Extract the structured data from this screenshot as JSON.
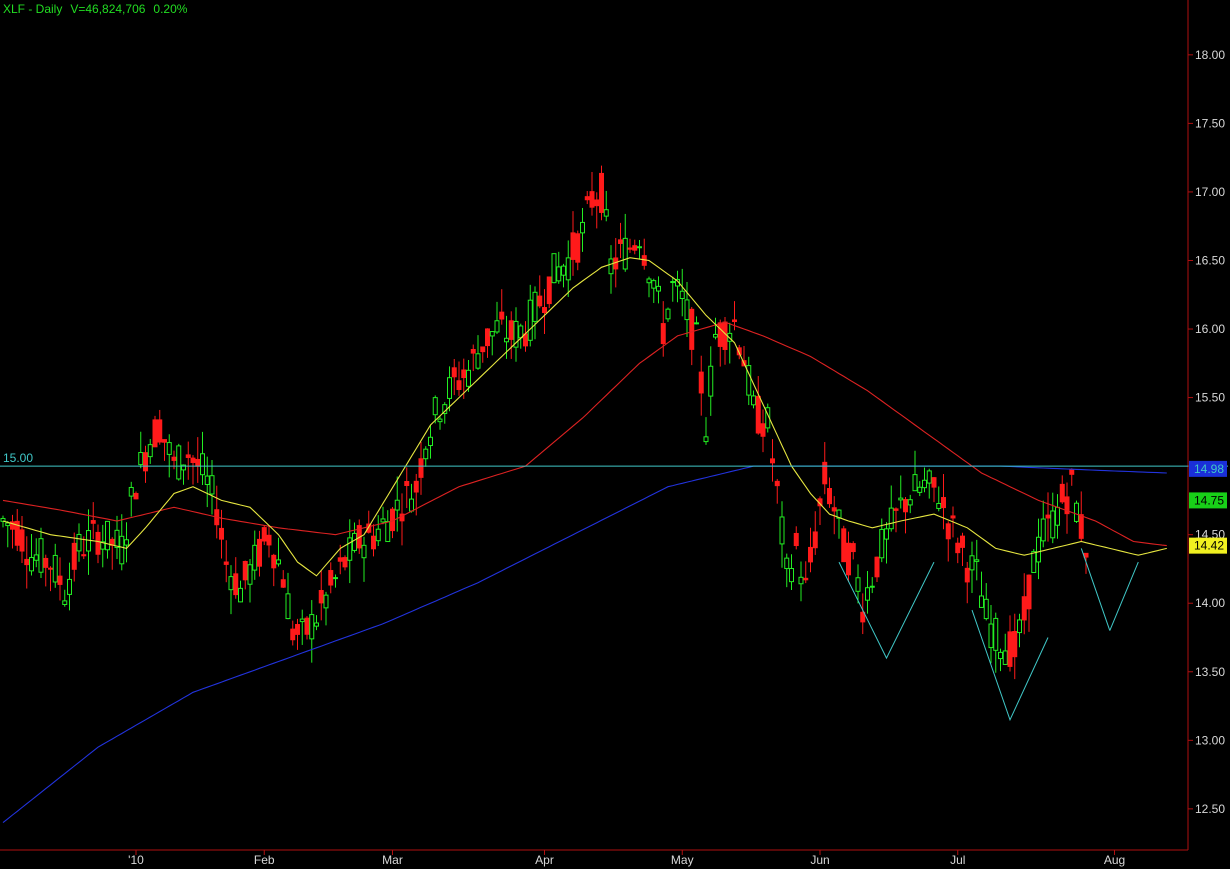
{
  "header": {
    "symbol_interval": "XLF - Daily",
    "volume": "V=46,824,706",
    "change": "0.20%"
  },
  "chart_data": {
    "type": "candlestick",
    "ylim": [
      12.2,
      18.4
    ],
    "y_ticks": [
      "18.00",
      "17.50",
      "17.00",
      "16.50",
      "16.00",
      "15.50",
      "15.00",
      "14.50",
      "14.00",
      "13.50",
      "13.00",
      "12.50"
    ],
    "x_ticks": [
      "'10",
      "Feb",
      "Mar",
      "Apr",
      "May",
      "Jun",
      "Jul",
      "Aug"
    ],
    "x_tick_bar_index": [
      28,
      55,
      82,
      114,
      143,
      172,
      201,
      234
    ],
    "bar_count": 229,
    "horizontal_line": {
      "label": "15.00",
      "value": 15.0,
      "color": "#40c8c8"
    },
    "price_badges": [
      {
        "label": "14.98",
        "value": 14.98,
        "bg": "#1a2fd8",
        "fg": "#40c8c8"
      },
      {
        "label": "14.75",
        "value": 14.75,
        "bg": "#18d018",
        "fg": "#000000"
      },
      {
        "label": "14.42",
        "value": 14.42,
        "bg": "#f0f020",
        "fg": "#000000"
      }
    ],
    "colors": {
      "up": "#22ee22",
      "down": "#ff1a1a",
      "ma_short": "#e6e640",
      "ma_mid": "#dd2222",
      "ma_long": "#2233dd",
      "pattern": "#40c8c8"
    },
    "price_anchors": [
      [
        0,
        14.6
      ],
      [
        3,
        14.55
      ],
      [
        6,
        14.35
      ],
      [
        10,
        14.3
      ],
      [
        13,
        14.1
      ],
      [
        16,
        14.4
      ],
      [
        20,
        14.5
      ],
      [
        25,
        14.4
      ],
      [
        28,
        14.9
      ],
      [
        31,
        15.2
      ],
      [
        33,
        15.3
      ],
      [
        36,
        15.0
      ],
      [
        39,
        15.1
      ],
      [
        42,
        14.95
      ],
      [
        45,
        14.7
      ],
      [
        47,
        14.3
      ],
      [
        50,
        14.1
      ],
      [
        53,
        14.3
      ],
      [
        56,
        14.5
      ],
      [
        59,
        14.2
      ],
      [
        61,
        13.8
      ],
      [
        63,
        13.75
      ],
      [
        66,
        13.9
      ],
      [
        69,
        14.1
      ],
      [
        72,
        14.3
      ],
      [
        75,
        14.45
      ],
      [
        78,
        14.5
      ],
      [
        81,
        14.6
      ],
      [
        84,
        14.75
      ],
      [
        87,
        14.85
      ],
      [
        89,
        15.2
      ],
      [
        92,
        15.45
      ],
      [
        95,
        15.6
      ],
      [
        98,
        15.7
      ],
      [
        101,
        15.9
      ],
      [
        104,
        16.0
      ],
      [
        107,
        15.95
      ],
      [
        110,
        16.0
      ],
      [
        113,
        16.2
      ],
      [
        116,
        16.4
      ],
      [
        119,
        16.5
      ],
      [
        122,
        16.7
      ],
      [
        124,
        16.95
      ],
      [
        126,
        17.0
      ],
      [
        128,
        16.45
      ],
      [
        130,
        16.55
      ],
      [
        132,
        16.6
      ],
      [
        134,
        16.7
      ],
      [
        137,
        16.35
      ],
      [
        139,
        16.0
      ],
      [
        141,
        16.3
      ],
      [
        143,
        16.2
      ],
      [
        146,
        15.9
      ],
      [
        148,
        15.3
      ],
      [
        150,
        15.95
      ],
      [
        152,
        16.0
      ],
      [
        154,
        16.05
      ],
      [
        156,
        15.8
      ],
      [
        158,
        15.4
      ],
      [
        161,
        15.3
      ],
      [
        163,
        14.8
      ],
      [
        165,
        14.2
      ],
      [
        167,
        14.4
      ],
      [
        169,
        14.1
      ],
      [
        171,
        14.5
      ],
      [
        173,
        14.9
      ],
      [
        175,
        14.7
      ],
      [
        177,
        14.4
      ],
      [
        179,
        14.3
      ],
      [
        181,
        14.0
      ],
      [
        183,
        14.2
      ],
      [
        185,
        14.4
      ],
      [
        187,
        14.55
      ],
      [
        189,
        14.7
      ],
      [
        191,
        14.8
      ],
      [
        194,
        14.85
      ],
      [
        197,
        14.8
      ],
      [
        199,
        14.6
      ],
      [
        201,
        14.45
      ],
      [
        203,
        14.3
      ],
      [
        205,
        14.2
      ],
      [
        207,
        13.9
      ],
      [
        209,
        13.75
      ],
      [
        211,
        13.7
      ],
      [
        213,
        13.65
      ],
      [
        215,
        13.9
      ],
      [
        217,
        14.3
      ],
      [
        219,
        14.5
      ],
      [
        221,
        14.6
      ],
      [
        223,
        14.75
      ],
      [
        225,
        14.85
      ],
      [
        227,
        14.55
      ],
      [
        229,
        14.3
      ],
      [
        231,
        14.2
      ],
      [
        233,
        14.1
      ],
      [
        235,
        14.0
      ],
      [
        237,
        14.25
      ],
      [
        239,
        14.5
      ],
      [
        241,
        14.9
      ],
      [
        243,
        14.7
      ],
      [
        245,
        14.75
      ]
    ],
    "ma_short_anchors": [
      [
        0,
        14.6
      ],
      [
        10,
        14.5
      ],
      [
        20,
        14.45
      ],
      [
        26,
        14.4
      ],
      [
        30,
        14.55
      ],
      [
        36,
        14.8
      ],
      [
        40,
        14.85
      ],
      [
        46,
        14.75
      ],
      [
        52,
        14.7
      ],
      [
        58,
        14.5
      ],
      [
        62,
        14.3
      ],
      [
        66,
        14.2
      ],
      [
        71,
        14.4
      ],
      [
        76,
        14.5
      ],
      [
        83,
        14.9
      ],
      [
        90,
        15.3
      ],
      [
        96,
        15.5
      ],
      [
        102,
        15.7
      ],
      [
        108,
        15.9
      ],
      [
        114,
        16.1
      ],
      [
        120,
        16.3
      ],
      [
        126,
        16.45
      ],
      [
        132,
        16.52
      ],
      [
        136,
        16.5
      ],
      [
        142,
        16.35
      ],
      [
        148,
        16.1
      ],
      [
        154,
        15.9
      ],
      [
        158,
        15.6
      ],
      [
        162,
        15.3
      ],
      [
        166,
        15.0
      ],
      [
        170,
        14.8
      ],
      [
        174,
        14.65
      ],
      [
        178,
        14.6
      ],
      [
        183,
        14.55
      ],
      [
        189,
        14.6
      ],
      [
        196,
        14.65
      ],
      [
        203,
        14.55
      ],
      [
        209,
        14.4
      ],
      [
        215,
        14.35
      ],
      [
        221,
        14.4
      ],
      [
        227,
        14.45
      ],
      [
        233,
        14.4
      ],
      [
        239,
        14.35
      ],
      [
        245,
        14.4
      ]
    ],
    "ma_mid_anchors": [
      [
        0,
        14.75
      ],
      [
        12,
        14.68
      ],
      [
        24,
        14.6
      ],
      [
        36,
        14.7
      ],
      [
        46,
        14.62
      ],
      [
        58,
        14.55
      ],
      [
        70,
        14.5
      ],
      [
        82,
        14.6
      ],
      [
        96,
        14.85
      ],
      [
        110,
        15.0
      ],
      [
        122,
        15.35
      ],
      [
        134,
        15.75
      ],
      [
        142,
        15.95
      ],
      [
        152,
        16.05
      ],
      [
        160,
        15.95
      ],
      [
        170,
        15.8
      ],
      [
        182,
        15.55
      ],
      [
        194,
        15.25
      ],
      [
        206,
        14.95
      ],
      [
        218,
        14.75
      ],
      [
        230,
        14.6
      ],
      [
        238,
        14.45
      ],
      [
        245,
        14.42
      ]
    ],
    "ma_long_anchors": [
      [
        0,
        12.4
      ],
      [
        20,
        12.95
      ],
      [
        40,
        13.35
      ],
      [
        60,
        13.6
      ],
      [
        80,
        13.85
      ],
      [
        100,
        14.15
      ],
      [
        120,
        14.5
      ],
      [
        140,
        14.85
      ],
      [
        158,
        15.0
      ],
      [
        180,
        15.0
      ],
      [
        210,
        15.0
      ],
      [
        230,
        14.97
      ],
      [
        245,
        14.95
      ]
    ],
    "pattern_lines": [
      [
        [
          176,
          14.3
        ],
        [
          186,
          13.6
        ],
        [
          196,
          14.3
        ]
      ],
      [
        [
          204,
          13.95
        ],
        [
          212,
          13.15
        ],
        [
          220,
          13.75
        ]
      ],
      [
        [
          227,
          14.4
        ],
        [
          233,
          13.8
        ]
      ],
      [
        [
          233,
          13.8
        ],
        [
          239,
          14.3
        ]
      ]
    ]
  }
}
